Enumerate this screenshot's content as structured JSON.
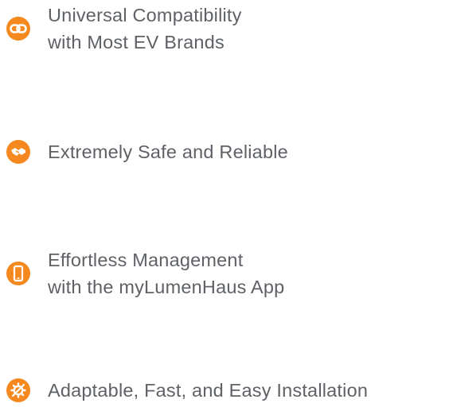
{
  "accent_color": "#f5891f",
  "text_color": "#5e6166",
  "features": [
    {
      "icon": "link-icon",
      "lines": [
        "Universal Compatibility",
        "with Most EV Brands"
      ]
    },
    {
      "icon": "handshake-icon",
      "lines": [
        "Extremely Safe and Reliable"
      ]
    },
    {
      "icon": "smartphone-icon",
      "lines": [
        "Effortless Management",
        "with the myLumenHaus App"
      ]
    },
    {
      "icon": "gear-wrench-icon",
      "lines": [
        "Adaptable, Fast, and Easy Installation"
      ]
    }
  ]
}
